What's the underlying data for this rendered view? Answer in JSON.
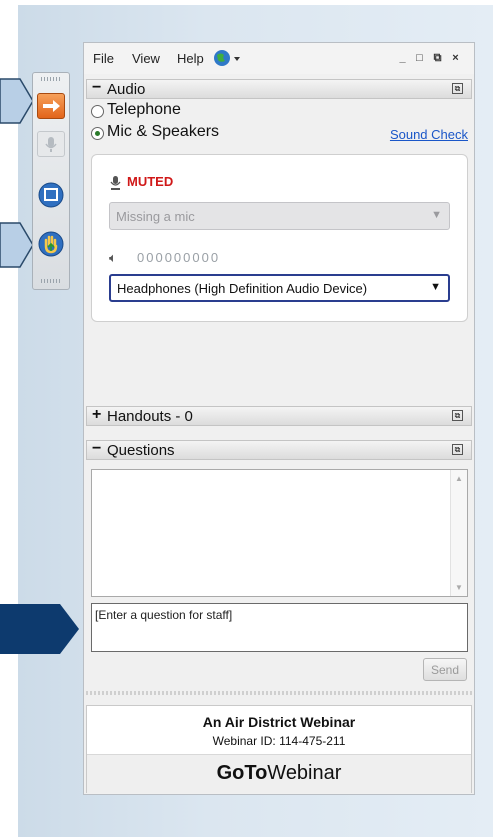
{
  "menu": {
    "file": "File",
    "view": "View",
    "help": "Help"
  },
  "window_controls": {
    "minimize": "_",
    "maximize": "□",
    "popout": "⧉",
    "close": "×"
  },
  "audio": {
    "header": "Audio",
    "options": [
      {
        "label": "Telephone",
        "selected": false
      },
      {
        "label": "Mic & Speakers",
        "selected": true
      }
    ],
    "sound_check": "Sound Check",
    "mic_status": "MUTED",
    "mic_device": "Missing a mic",
    "speaker_level": "000000000",
    "speaker_device": "Headphones (High Definition Audio Device)"
  },
  "handouts": {
    "header": "Handouts - 0"
  },
  "questions": {
    "header": "Questions",
    "input_placeholder": "[Enter a question for staff]",
    "send_label": "Send"
  },
  "webinar": {
    "title": "An Air District Webinar",
    "id_text": "Webinar ID: 114-475-211",
    "brand_bold": "GoTo",
    "brand_light": "Webinar"
  },
  "colors": {
    "accent_link": "#1a56c8",
    "muted_red": "#d01818",
    "callout_fill": "#b8cfe6",
    "callout_dark": "#0d3a6e",
    "toolbar_orange": "#e8731c"
  },
  "icons": [
    "globe-icon",
    "arrow-icon",
    "microphone-icon",
    "screen-icon",
    "raise-hand-icon",
    "speaker-icon"
  ]
}
